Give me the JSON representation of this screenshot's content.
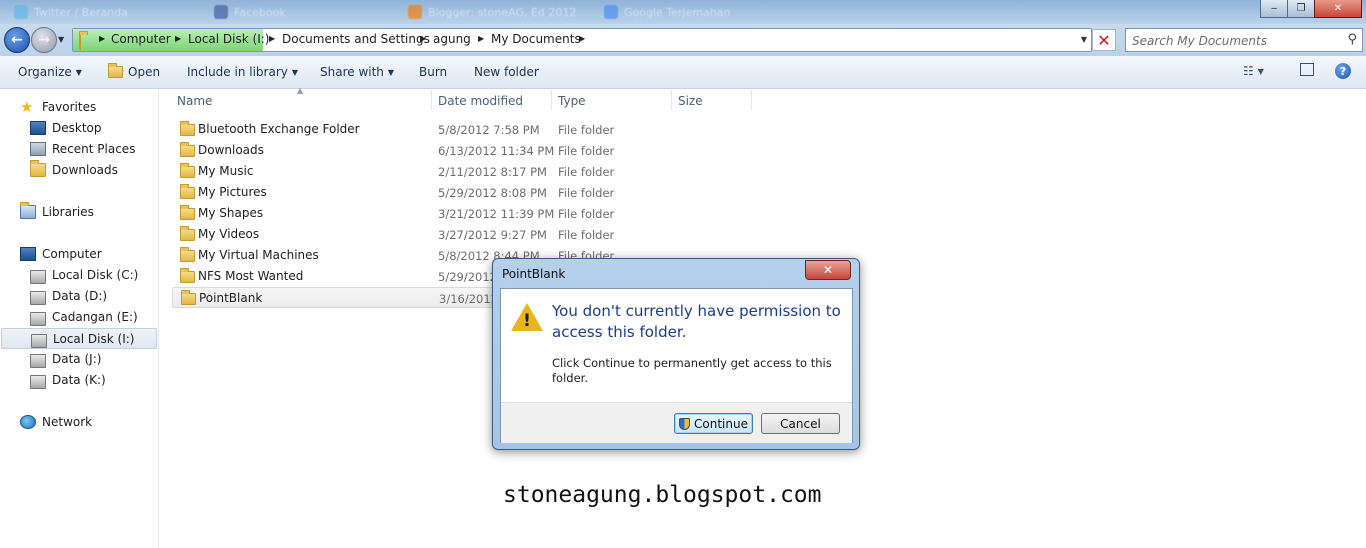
{
  "titlebar": {
    "tabs": [
      "Twitter / Beranda",
      "Facebook",
      "Blogger: stoneAG, Ed 2012",
      "Google Terjemahan"
    ],
    "controls": {
      "minimize": "‒",
      "maximize": "❐",
      "close": "✕"
    }
  },
  "address": {
    "crumbs": [
      "Computer",
      "Local Disk (I:)",
      "Documents and Settings",
      "agung",
      "My Documents"
    ],
    "search_placeholder": "Search My Documents"
  },
  "toolbar": {
    "organize": "Organize",
    "open": "Open",
    "include_in_library": "Include in library",
    "share_with": "Share with",
    "burn": "Burn",
    "new_folder": "New folder"
  },
  "nav": {
    "favorites": "Favorites",
    "desktop": "Desktop",
    "recent_places": "Recent Places",
    "downloads": "Downloads",
    "libraries": "Libraries",
    "computer": "Computer",
    "drives": [
      "Local Disk (C:)",
      "Data (D:)",
      "Cadangan (E:)",
      "Local Disk (I:)",
      "Data (J:)",
      "Data (K:)"
    ],
    "network": "Network"
  },
  "columns": {
    "name": "Name",
    "date": "Date modified",
    "type": "Type",
    "size": "Size"
  },
  "files": [
    {
      "name": "Bluetooth Exchange Folder",
      "date": "5/8/2012 7:58 PM",
      "type": "File folder"
    },
    {
      "name": "Downloads",
      "date": "6/13/2012 11:34 PM",
      "type": "File folder"
    },
    {
      "name": "My Music",
      "date": "2/11/2012 8:17 PM",
      "type": "File folder"
    },
    {
      "name": "My Pictures",
      "date": "5/29/2012 8:08 PM",
      "type": "File folder"
    },
    {
      "name": "My Shapes",
      "date": "3/21/2012 11:39 PM",
      "type": "File folder"
    },
    {
      "name": "My Videos",
      "date": "3/27/2012 9:27 PM",
      "type": "File folder"
    },
    {
      "name": "My Virtual Machines",
      "date": "5/8/2012 8:44 PM",
      "type": "File folder"
    },
    {
      "name": "NFS Most Wanted",
      "date": "5/29/2012",
      "type": ""
    },
    {
      "name": "PointBlank",
      "date": "3/16/2012",
      "type": ""
    }
  ],
  "dialog": {
    "title": "PointBlank",
    "main": "You don't currently have permission to access this folder.",
    "sub": "Click Continue to permanently get access to this folder.",
    "continue": "Continue",
    "cancel": "Cancel"
  },
  "watermark": "stoneagung.blogspot.com"
}
